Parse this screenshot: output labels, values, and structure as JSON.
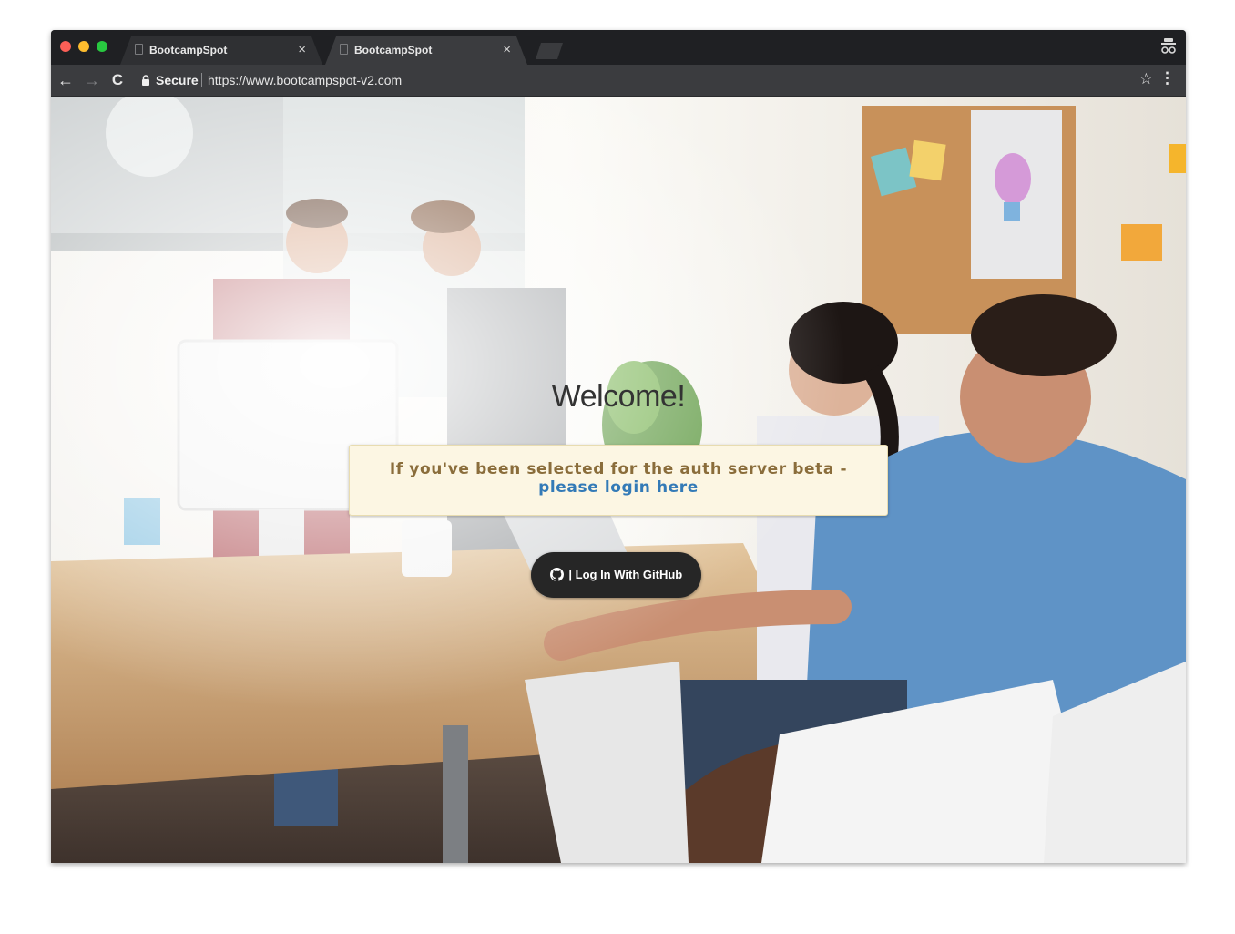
{
  "browser": {
    "tabs": [
      {
        "title": "BootcampSpot",
        "close": "×"
      },
      {
        "title": "BootcampSpot",
        "close": "×"
      }
    ],
    "toolbar": {
      "back": "←",
      "forward": "→",
      "reload": "C",
      "secure_label": "Secure",
      "url": "https://www.bootcampspot-v2.com",
      "star": "☆",
      "menu": "⋮"
    }
  },
  "page": {
    "heading": "Welcome!",
    "beta_notice": {
      "text": "If you've been selected for the auth server beta -",
      "link_text": "please login here"
    },
    "github_button": {
      "label": "| Log In With GitHub",
      "icon": "github-icon"
    }
  },
  "colors": {
    "notice_bg": "#fcf6e3",
    "notice_text": "#8a6d3b",
    "link": "#337ab7",
    "github_button_bg": "#262626"
  }
}
